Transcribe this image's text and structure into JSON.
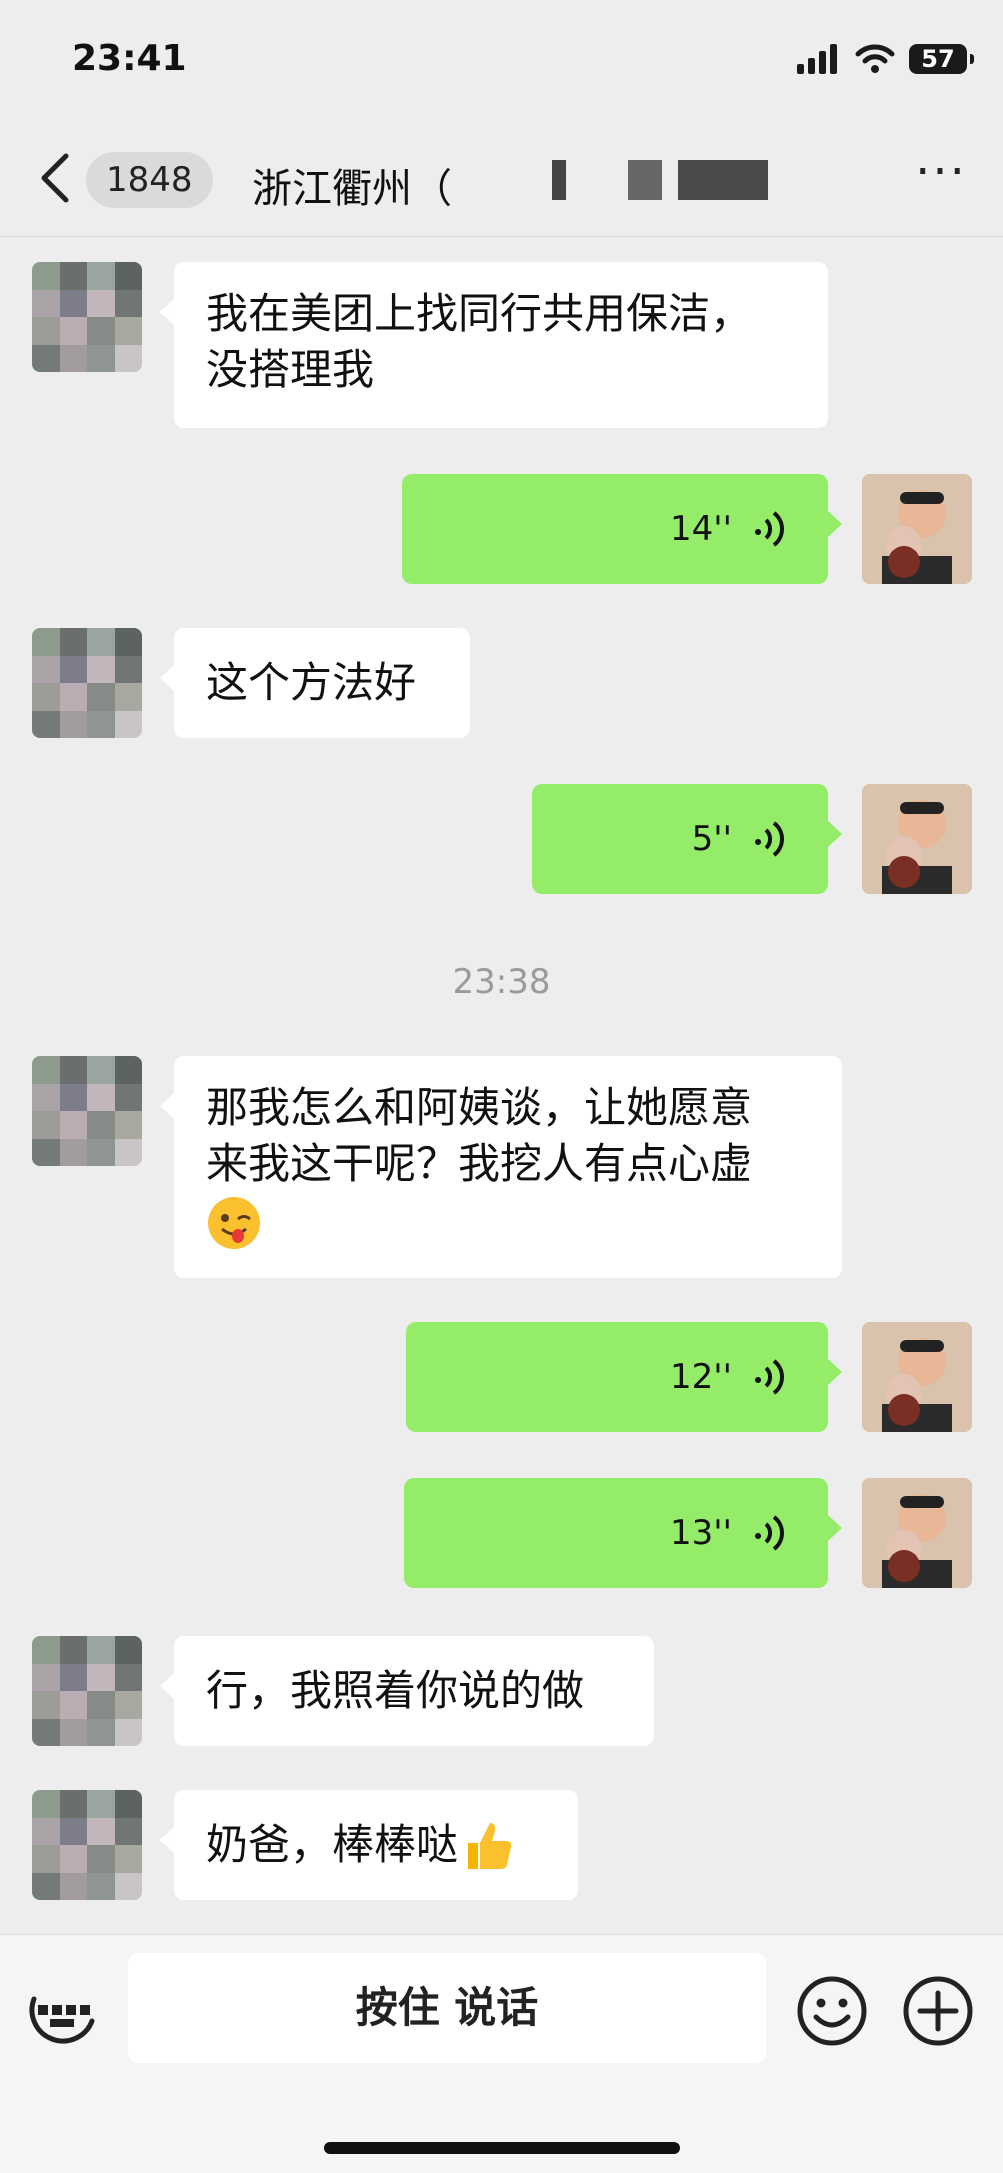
{
  "status": {
    "time": "23:41",
    "battery": "57"
  },
  "nav": {
    "count": "1848",
    "title": "浙江衢州（"
  },
  "messages": {
    "m1": {
      "text1": "我在美团上找同行共用保洁，",
      "text2": "没搭理我"
    },
    "v1": {
      "duration": "14''"
    },
    "m2": {
      "text1": "这个方法好"
    },
    "v2": {
      "duration": "5''"
    },
    "timestamp": "23:38",
    "m3": {
      "text1": "那我怎么和阿姨谈，让她愿意",
      "text2": "来我这干呢？我挖人有点心虚"
    },
    "v3": {
      "duration": "12''"
    },
    "v4": {
      "duration": "13''"
    },
    "m4": {
      "text1": "行，我照着你说的做"
    },
    "m5": {
      "text1": "奶爸，棒棒哒"
    }
  },
  "input": {
    "hold_to_talk": "按住 说话"
  }
}
